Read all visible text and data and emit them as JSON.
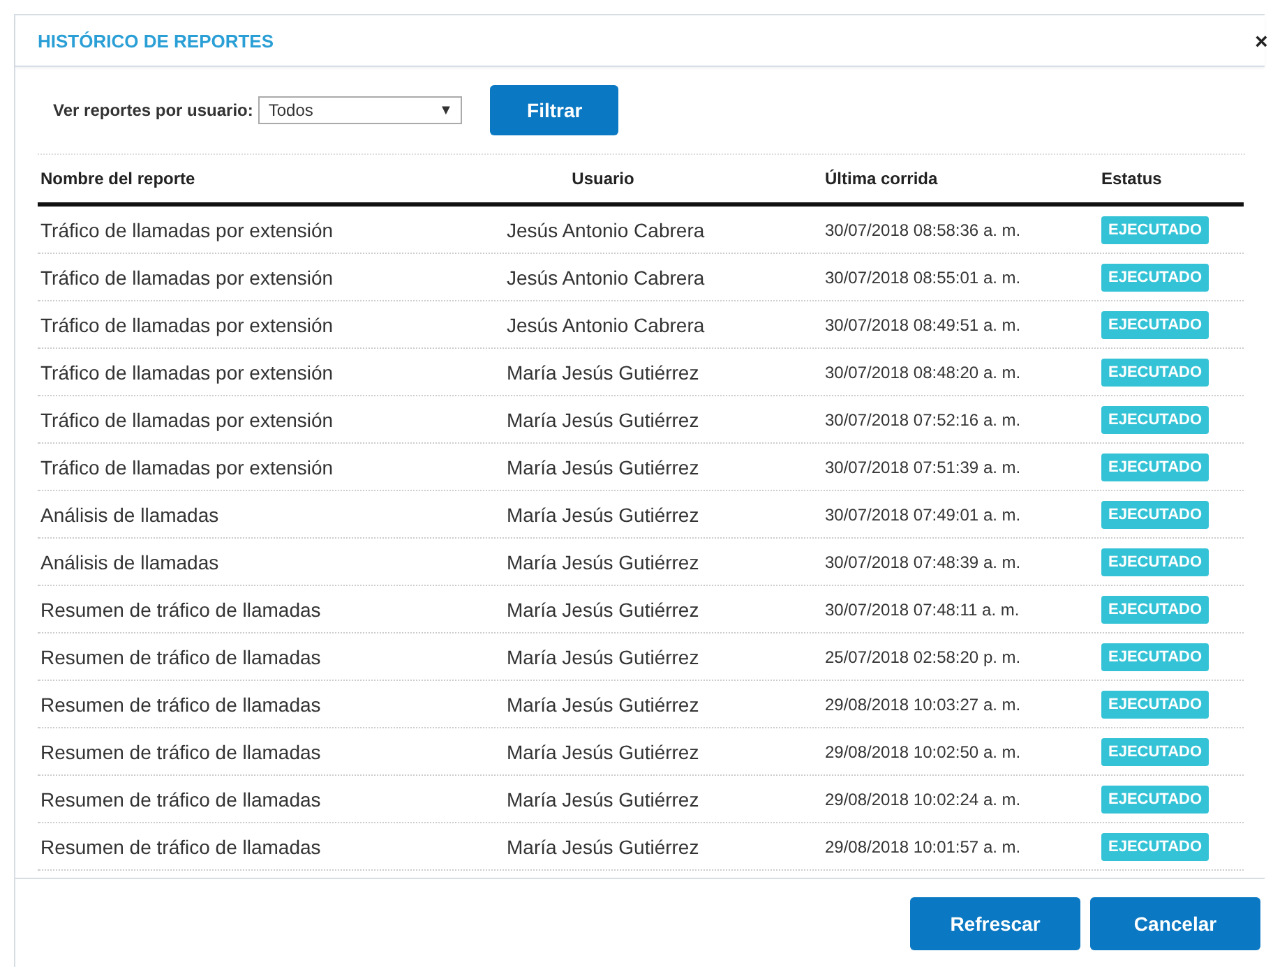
{
  "dialog": {
    "title": "HISTÓRICO DE REPORTES",
    "close": "×"
  },
  "filter": {
    "label": "Ver reportes por usuario:",
    "value": "Todos",
    "arrow": "▼",
    "button": "Filtrar"
  },
  "table": {
    "columns": [
      "Nombre del reporte",
      "Usuario",
      "Última corrida",
      "Estatus"
    ],
    "rows": [
      {
        "report": "Tráfico de llamadas por extensión",
        "user": "Jesús Antonio Cabrera",
        "last_run": "30/07/2018 08:58:36 a. m.",
        "status": "EJECUTADO"
      },
      {
        "report": "Tráfico de llamadas por extensión",
        "user": "Jesús Antonio Cabrera",
        "last_run": "30/07/2018 08:55:01 a. m.",
        "status": "EJECUTADO"
      },
      {
        "report": "Tráfico de llamadas por extensión",
        "user": "Jesús Antonio Cabrera",
        "last_run": "30/07/2018 08:49:51 a. m.",
        "status": "EJECUTADO"
      },
      {
        "report": "Tráfico de llamadas por extensión",
        "user": "María Jesús Gutiérrez",
        "last_run": "30/07/2018 08:48:20 a. m.",
        "status": "EJECUTADO"
      },
      {
        "report": "Tráfico de llamadas por extensión",
        "user": "María Jesús Gutiérrez",
        "last_run": "30/07/2018 07:52:16 a. m.",
        "status": "EJECUTADO"
      },
      {
        "report": "Tráfico de llamadas por extensión",
        "user": "María Jesús Gutiérrez",
        "last_run": "30/07/2018 07:51:39 a. m.",
        "status": "EJECUTADO"
      },
      {
        "report": "Análisis de llamadas",
        "user": "María Jesús Gutiérrez",
        "last_run": "30/07/2018 07:49:01 a. m.",
        "status": "EJECUTADO"
      },
      {
        "report": "Análisis de llamadas",
        "user": "María Jesús Gutiérrez",
        "last_run": "30/07/2018 07:48:39 a. m.",
        "status": "EJECUTADO"
      },
      {
        "report": "Resumen de tráfico de llamadas",
        "user": "María Jesús Gutiérrez",
        "last_run": "30/07/2018 07:48:11 a. m.",
        "status": "EJECUTADO"
      },
      {
        "report": "Resumen de tráfico de llamadas",
        "user": "María Jesús Gutiérrez",
        "last_run": "25/07/2018 02:58:20 p. m.",
        "status": "EJECUTADO"
      },
      {
        "report": "Resumen de tráfico de llamadas",
        "user": "María Jesús Gutiérrez",
        "last_run": "29/08/2018 10:03:27 a. m.",
        "status": "EJECUTADO"
      },
      {
        "report": "Resumen de tráfico de llamadas",
        "user": "María Jesús Gutiérrez",
        "last_run": "29/08/2018 10:02:50 a. m.",
        "status": "EJECUTADO"
      },
      {
        "report": "Resumen de tráfico de llamadas",
        "user": "María Jesús Gutiérrez",
        "last_run": "29/08/2018 10:02:24 a. m.",
        "status": "EJECUTADO"
      },
      {
        "report": "Resumen de tráfico de llamadas",
        "user": "María Jesús Gutiérrez",
        "last_run": "29/08/2018 10:01:57 a. m.",
        "status": "EJECUTADO"
      }
    ]
  },
  "buttons": [
    "Refrescar",
    "Cancelar"
  ]
}
